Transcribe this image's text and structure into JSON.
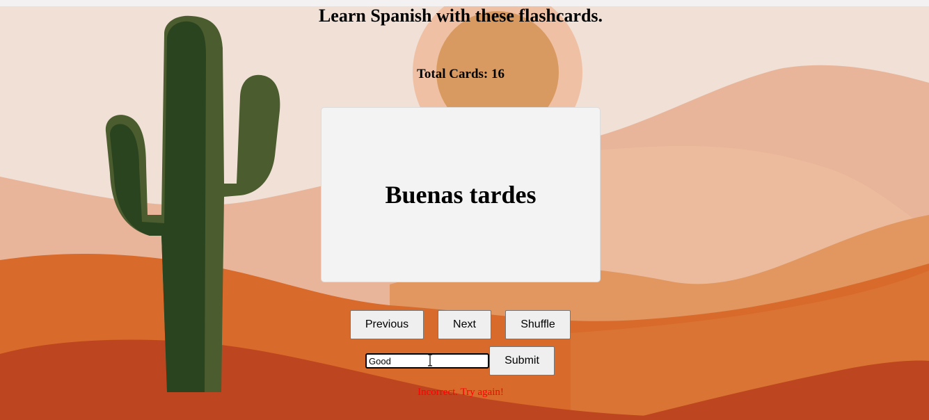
{
  "page": {
    "title": "Learn Spanish with these flashcards.",
    "total_cards": "Total Cards: 16"
  },
  "card": {
    "text": "Buenas tardes"
  },
  "controls": {
    "previous_label": "Previous",
    "next_label": "Next",
    "shuffle_label": "Shuffle",
    "submit_label": "Submit",
    "answer_value": "Good"
  },
  "feedback": {
    "message": "Incorrect. Try again!",
    "color": "#ff0000"
  },
  "theme": {
    "sky": "#f0e0d6",
    "sun": "#d89a60",
    "cactus_dark": "#2a4420",
    "cactus_light": "#4b5c2f",
    "dune_light": "#e9b59a",
    "dune_mid": "#d86a2b",
    "dune_dark": "#bd4520"
  }
}
